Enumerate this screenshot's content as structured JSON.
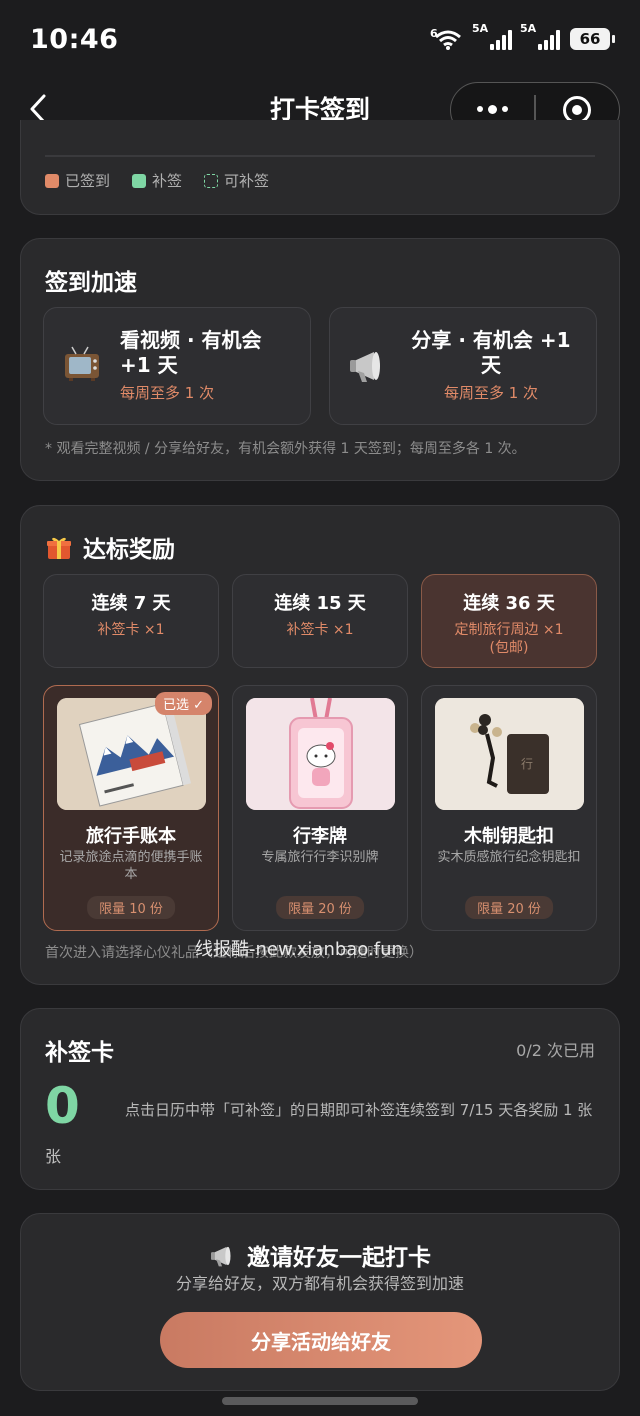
{
  "status_bar": {
    "time": "10:46",
    "wifi_label": "6",
    "sim1": "5A",
    "sim2": "5A",
    "battery": "66"
  },
  "nav": {
    "title": "打卡签到"
  },
  "legend": [
    {
      "label": "已签到",
      "color": "#e08a68"
    },
    {
      "label": "补签",
      "color": "#7fd6a4"
    },
    {
      "label": "可补签",
      "color": "dashed"
    }
  ],
  "speed": {
    "title": "签到加速",
    "options": [
      {
        "icon": "tv-icon",
        "main": "看视频 · 有机会 +1 天",
        "sub": "每周至多 1 次"
      },
      {
        "icon": "megaphone-icon",
        "main": "分享 · 有机会 +1 天",
        "sub": "每周至多 1 次"
      }
    ],
    "note": "* 观看完整视频 / 分享给好友，有机会额外获得 1 天签到；每周至多各 1 次。"
  },
  "reward": {
    "title": "达标奖励",
    "tiers": [
      {
        "title": "连续 7 天",
        "reward": "补签卡 ×1"
      },
      {
        "title": "连续 15 天",
        "reward": "补签卡 ×1"
      },
      {
        "title": "连续 36 天",
        "reward": "定制旅行周边 ×1",
        "reward2": "(包邮)"
      }
    ],
    "prizes": [
      {
        "name": "旅行手账本",
        "desc": "记录旅途点滴的便携手账本",
        "limit": "限量 10 份",
        "badge": "已选 ✓"
      },
      {
        "name": "行李牌",
        "desc": "专属旅行行李识别牌",
        "limit": "限量 20 份"
      },
      {
        "name": "木制钥匙扣",
        "desc": "实木质感旅行纪念钥匙扣",
        "limit": "限量 20 份"
      }
    ],
    "note": "首次进入请选择心仪礼品（达标后按此款发放，可随时更换）",
    "watermark": "线报酷-new.xianbao.fun"
  },
  "makeup": {
    "title": "补签卡",
    "used": "0/2 次已用",
    "count": "0",
    "unit": "张",
    "desc": "点击日历中带「可补签」的日期即可补签连续签到 7/15 天各奖励 1 张"
  },
  "invite": {
    "title": "邀请好友一起打卡",
    "subtitle": "分享给好友，双方都有机会获得签到加速",
    "button": "分享活动给好友"
  }
}
